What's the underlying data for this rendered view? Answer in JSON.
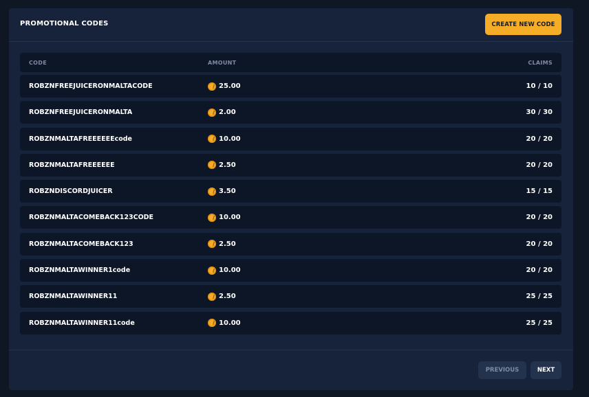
{
  "header": {
    "title": "PROMOTIONAL CODES",
    "create_button": "CREATE NEW CODE"
  },
  "table": {
    "columns": {
      "code": "CODE",
      "amount": "AMOUNT",
      "claims": "CLAIMS"
    },
    "rows": [
      {
        "code": "ROBZNFREEJUICERONMALTACODE",
        "amount": "25.00",
        "claims": "10 / 10"
      },
      {
        "code": "ROBZNFREEJUICERONMALTA",
        "amount": "2.00",
        "claims": "30 / 30"
      },
      {
        "code": "ROBZNMALTAFREEEEEEcode",
        "amount": "10.00",
        "claims": "20 / 20"
      },
      {
        "code": "ROBZNMALTAFREEEEEE",
        "amount": "2.50",
        "claims": "20 / 20"
      },
      {
        "code": "ROBZNDISCORDJUICER",
        "amount": "3.50",
        "claims": "15 / 15"
      },
      {
        "code": "ROBZNMALTACOMEBACK123CODE",
        "amount": "10.00",
        "claims": "20 / 20"
      },
      {
        "code": "ROBZNMALTACOMEBACK123",
        "amount": "2.50",
        "claims": "20 / 20"
      },
      {
        "code": "ROBZNMALTAWINNER1code",
        "amount": "10.00",
        "claims": "20 / 20"
      },
      {
        "code": "ROBZNMALTAWINNER11",
        "amount": "2.50",
        "claims": "25 / 25"
      },
      {
        "code": "ROBZNMALTAWINNER11code",
        "amount": "10.00",
        "claims": "25 / 25"
      }
    ]
  },
  "pagination": {
    "previous": "PREVIOUS",
    "next": "NEXT"
  },
  "icons": {
    "amount_icon": "coin-icon"
  },
  "colors": {
    "accent": "#f5ad27",
    "panel": "#17233a",
    "row": "#0d1626"
  }
}
